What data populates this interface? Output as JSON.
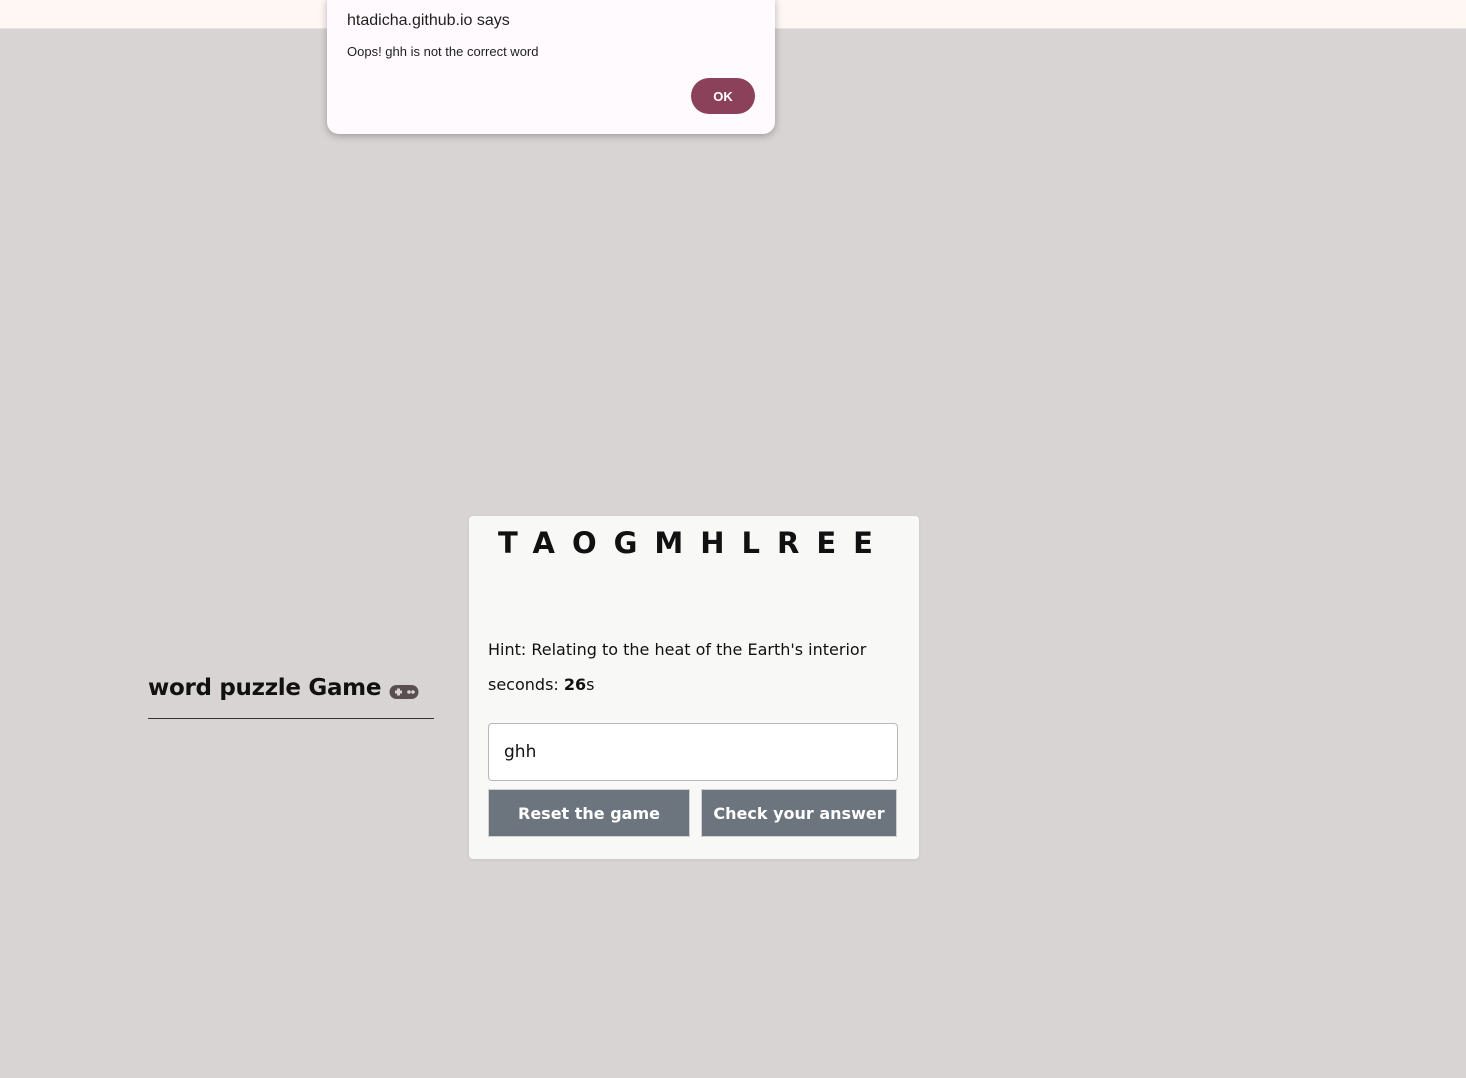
{
  "alert": {
    "title": "htadicha.github.io says",
    "message": "Oops! ghh is not the correct word",
    "ok_label": "OK",
    "ok_color": "#8b4159"
  },
  "game": {
    "title": "word puzzle Game",
    "title_icon": "gamepad-icon",
    "scrambled_word": "TAOGMHLREE",
    "hint": "Hint: Relating to the heat of the Earth's interior",
    "timer_label": "seconds: ",
    "timer_value": "26",
    "timer_unit": "s",
    "input_value": "ghh",
    "reset_label": "Reset the game",
    "check_label": "Check your answer",
    "button_color": "#6c757d"
  }
}
